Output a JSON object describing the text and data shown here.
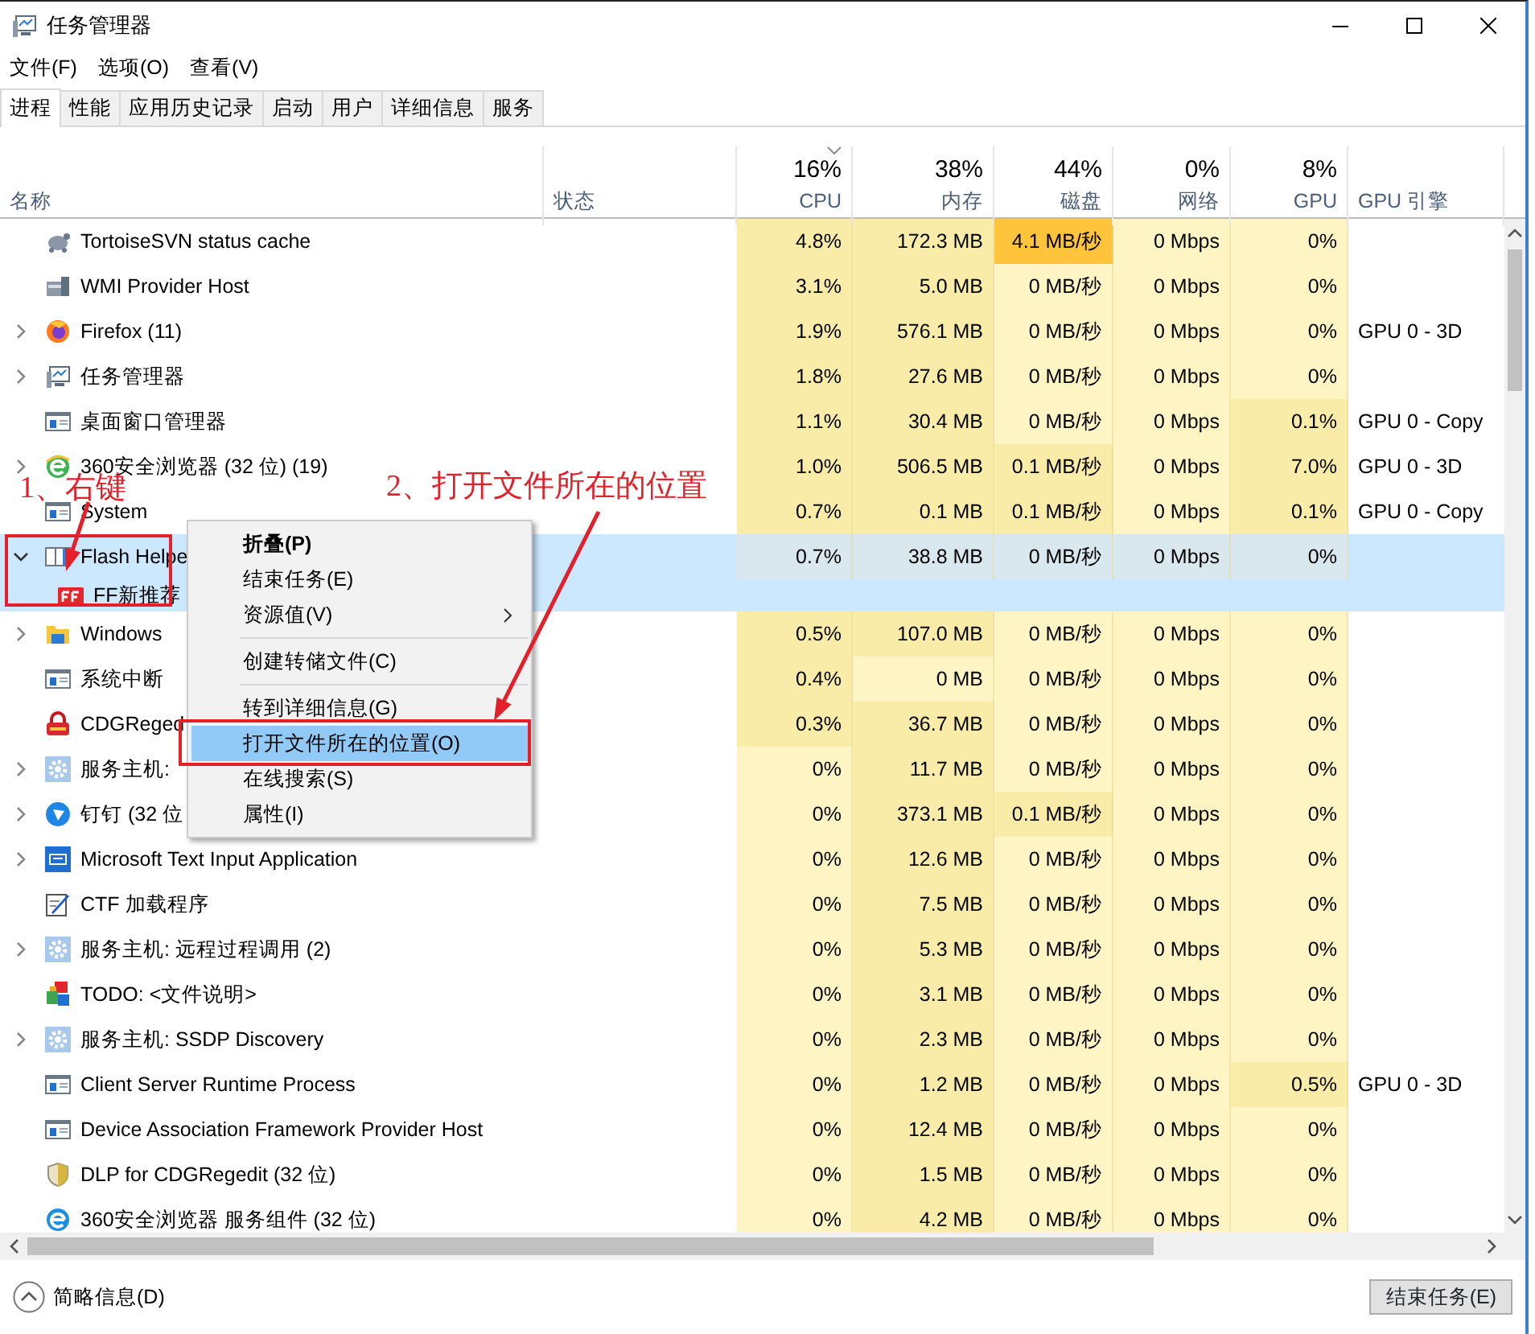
{
  "window": {
    "title": "任务管理器"
  },
  "menu": [
    "文件(F)",
    "选项(O)",
    "查看(V)"
  ],
  "tabs": [
    {
      "label": "进程",
      "selected": true
    },
    {
      "label": "性能",
      "selected": false
    },
    {
      "label": "应用历史记录",
      "selected": false
    },
    {
      "label": "启动",
      "selected": false
    },
    {
      "label": "用户",
      "selected": false
    },
    {
      "label": "详细信息",
      "selected": false
    },
    {
      "label": "服务",
      "selected": false
    }
  ],
  "columns": [
    {
      "kind": "text",
      "label": "名称"
    },
    {
      "kind": "text",
      "label": "状态"
    },
    {
      "kind": "metric",
      "percent": "16%",
      "label": "CPU",
      "sorted": true
    },
    {
      "kind": "metric",
      "percent": "38%",
      "label": "内存"
    },
    {
      "kind": "metric",
      "percent": "44%",
      "label": "磁盘"
    },
    {
      "kind": "metric",
      "percent": "0%",
      "label": "网络"
    },
    {
      "kind": "metric",
      "percent": "8%",
      "label": "GPU"
    },
    {
      "kind": "text",
      "label": "GPU 引擎"
    }
  ],
  "rows": [
    {
      "name": "TortoiseSVN status cache",
      "kind": "turtle",
      "selected": false,
      "cells": [
        {
          "text": "4.8%",
          "kind": "mid"
        },
        {
          "text": "172.3 MB",
          "kind": "mid"
        },
        {
          "text": "4.1 MB/秒",
          "kind": "high"
        },
        {
          "text": "0 Mbps",
          "kind": "low"
        },
        {
          "text": "0%",
          "kind": "low"
        }
      ]
    },
    {
      "name": "WMI Provider Host",
      "kind": "server",
      "selected": false,
      "cells": [
        {
          "text": "3.1%",
          "kind": "mid"
        },
        {
          "text": "5.0 MB",
          "kind": "mid"
        },
        {
          "text": "0 MB/秒",
          "kind": "low"
        },
        {
          "text": "0 Mbps",
          "kind": "low"
        },
        {
          "text": "0%",
          "kind": "low"
        }
      ]
    },
    {
      "name": "Firefox (11)",
      "kind": "globe",
      "expanded": false,
      "selected": false,
      "cells": [
        {
          "text": "1.9%",
          "kind": "mid"
        },
        {
          "text": "576.1 MB",
          "kind": "mid"
        },
        {
          "text": "0 MB/秒",
          "kind": "low"
        },
        {
          "text": "0 Mbps",
          "kind": "low"
        },
        {
          "text": "0%",
          "kind": "low"
        }
      ],
      "engine": "GPU 0 - 3D"
    },
    {
      "name": "任务管理器",
      "kind": "monitor",
      "expanded": false,
      "selected": false,
      "cells": [
        {
          "text": "1.8%",
          "kind": "mid"
        },
        {
          "text": "27.6 MB",
          "kind": "mid"
        },
        {
          "text": "0 MB/秒",
          "kind": "low"
        },
        {
          "text": "0 Mbps",
          "kind": "low"
        },
        {
          "text": "0%",
          "kind": "low"
        }
      ]
    },
    {
      "name": "桌面窗口管理器",
      "kind": "window",
      "selected": false,
      "cells": [
        {
          "text": "1.1%",
          "kind": "mid"
        },
        {
          "text": "30.4 MB",
          "kind": "mid"
        },
        {
          "text": "0 MB/秒",
          "kind": "low"
        },
        {
          "text": "0 Mbps",
          "kind": "low"
        },
        {
          "text": "0.1%",
          "kind": "mid"
        }
      ],
      "engine": "GPU 0 - Copy"
    },
    {
      "name": "360安全浏览器 (32 位) (19)",
      "kind": "browser",
      "expanded": false,
      "selected": false,
      "cells": [
        {
          "text": "1.0%",
          "kind": "mid"
        },
        {
          "text": "506.5 MB",
          "kind": "mid"
        },
        {
          "text": "0.1 MB/秒",
          "kind": "mid"
        },
        {
          "text": "0 Mbps",
          "kind": "low"
        },
        {
          "text": "7.0%",
          "kind": "mid"
        }
      ],
      "engine": "GPU 0 - 3D"
    },
    {
      "name": "System",
      "kind": "window",
      "selected": false,
      "cells": [
        {
          "text": "0.7%",
          "kind": "mid"
        },
        {
          "text": "0.1 MB",
          "kind": "mid"
        },
        {
          "text": "0.1 MB/秒",
          "kind": "mid"
        },
        {
          "text": "0 Mbps",
          "kind": "low"
        },
        {
          "text": "0.1%",
          "kind": "mid"
        }
      ],
      "engine": "GPU 0 - Copy"
    },
    {
      "name": "Flash Helpe",
      "kind": "split",
      "expanded": true,
      "selected": true,
      "cells": [
        {
          "text": "0.7%",
          "kind": "mid"
        },
        {
          "text": "38.8 MB",
          "kind": "mid"
        },
        {
          "text": "0 MB/秒",
          "kind": "low"
        },
        {
          "text": "0 Mbps",
          "kind": "low"
        },
        {
          "text": "0%",
          "kind": "low"
        }
      ],
      "children": [
        {
          "name": "FF新推荐",
          "kind": "badge"
        }
      ]
    },
    {
      "name": "Windows",
      "kind": "folder",
      "expanded": false,
      "selected": false,
      "cells": [
        {
          "text": "0.5%",
          "kind": "mid"
        },
        {
          "text": "107.0 MB",
          "kind": "mid"
        },
        {
          "text": "0 MB/秒",
          "kind": "low"
        },
        {
          "text": "0 Mbps",
          "kind": "low"
        },
        {
          "text": "0%",
          "kind": "low"
        }
      ]
    },
    {
      "name": "系统中断",
      "kind": "window",
      "selected": false,
      "cells": [
        {
          "text": "0.4%",
          "kind": "mid"
        },
        {
          "text": "0 MB",
          "kind": "low"
        },
        {
          "text": "0 MB/秒",
          "kind": "low"
        },
        {
          "text": "0 Mbps",
          "kind": "low"
        },
        {
          "text": "0%",
          "kind": "low"
        }
      ]
    },
    {
      "name": "CDGReged",
      "kind": "lock",
      "selected": false,
      "cells": [
        {
          "text": "0.3%",
          "kind": "mid"
        },
        {
          "text": "36.7 MB",
          "kind": "mid"
        },
        {
          "text": "0 MB/秒",
          "kind": "low"
        },
        {
          "text": "0 Mbps",
          "kind": "low"
        },
        {
          "text": "0%",
          "kind": "low"
        }
      ]
    },
    {
      "name": "服务主机:",
      "kind": "gear",
      "expanded": false,
      "selected": false,
      "cells": [
        {
          "text": "0%",
          "kind": "low"
        },
        {
          "text": "11.7 MB",
          "kind": "mid"
        },
        {
          "text": "0 MB/秒",
          "kind": "low"
        },
        {
          "text": "0 Mbps",
          "kind": "low"
        },
        {
          "text": "0%",
          "kind": "low"
        }
      ]
    },
    {
      "name": "钉钉 (32 位",
      "kind": "disc",
      "expanded": false,
      "selected": false,
      "cells": [
        {
          "text": "0%",
          "kind": "low"
        },
        {
          "text": "373.1 MB",
          "kind": "mid"
        },
        {
          "text": "0.1 MB/秒",
          "kind": "mid"
        },
        {
          "text": "0 Mbps",
          "kind": "low"
        },
        {
          "text": "0%",
          "kind": "low"
        }
      ]
    },
    {
      "name": "Microsoft Text Input Application",
      "kind": "keyboard",
      "expanded": false,
      "selected": false,
      "cells": [
        {
          "text": "0%",
          "kind": "low"
        },
        {
          "text": "12.6 MB",
          "kind": "mid"
        },
        {
          "text": "0 MB/秒",
          "kind": "low"
        },
        {
          "text": "0 Mbps",
          "kind": "low"
        },
        {
          "text": "0%",
          "kind": "low"
        }
      ]
    },
    {
      "name": "CTF 加载程序",
      "kind": "pen",
      "selected": false,
      "cells": [
        {
          "text": "0%",
          "kind": "low"
        },
        {
          "text": "7.5 MB",
          "kind": "mid"
        },
        {
          "text": "0 MB/秒",
          "kind": "low"
        },
        {
          "text": "0 Mbps",
          "kind": "low"
        },
        {
          "text": "0%",
          "kind": "low"
        }
      ]
    },
    {
      "name": "服务主机: 远程过程调用 (2)",
      "kind": "gear",
      "expanded": false,
      "selected": false,
      "cells": [
        {
          "text": "0%",
          "kind": "low"
        },
        {
          "text": "5.3 MB",
          "kind": "mid"
        },
        {
          "text": "0 MB/秒",
          "kind": "low"
        },
        {
          "text": "0 Mbps",
          "kind": "low"
        },
        {
          "text": "0%",
          "kind": "low"
        }
      ]
    },
    {
      "name": "TODO: <文件说明>",
      "kind": "tiles",
      "selected": false,
      "cells": [
        {
          "text": "0%",
          "kind": "low"
        },
        {
          "text": "3.1 MB",
          "kind": "mid"
        },
        {
          "text": "0 MB/秒",
          "kind": "low"
        },
        {
          "text": "0 Mbps",
          "kind": "low"
        },
        {
          "text": "0%",
          "kind": "low"
        }
      ]
    },
    {
      "name": "服务主机: SSDP Discovery",
      "kind": "gear",
      "expanded": false,
      "selected": false,
      "cells": [
        {
          "text": "0%",
          "kind": "low"
        },
        {
          "text": "2.3 MB",
          "kind": "mid"
        },
        {
          "text": "0 MB/秒",
          "kind": "low"
        },
        {
          "text": "0 Mbps",
          "kind": "low"
        },
        {
          "text": "0%",
          "kind": "low"
        }
      ]
    },
    {
      "name": "Client Server Runtime Process",
      "kind": "window",
      "selected": false,
      "cells": [
        {
          "text": "0%",
          "kind": "low"
        },
        {
          "text": "1.2 MB",
          "kind": "mid"
        },
        {
          "text": "0 MB/秒",
          "kind": "low"
        },
        {
          "text": "0 Mbps",
          "kind": "low"
        },
        {
          "text": "0.5%",
          "kind": "mid"
        }
      ],
      "engine": "GPU 0 - 3D"
    },
    {
      "name": "Device Association Framework Provider Host",
      "kind": "window",
      "selected": false,
      "cells": [
        {
          "text": "0%",
          "kind": "low"
        },
        {
          "text": "12.4 MB",
          "kind": "mid"
        },
        {
          "text": "0 MB/秒",
          "kind": "low"
        },
        {
          "text": "0 Mbps",
          "kind": "low"
        },
        {
          "text": "0%",
          "kind": "low"
        }
      ]
    },
    {
      "name": "DLP for CDGRegedit (32 位)",
      "kind": "shield",
      "selected": false,
      "cells": [
        {
          "text": "0%",
          "kind": "low"
        },
        {
          "text": "1.5 MB",
          "kind": "mid"
        },
        {
          "text": "0 MB/秒",
          "kind": "low"
        },
        {
          "text": "0 Mbps",
          "kind": "low"
        },
        {
          "text": "0%",
          "kind": "low"
        }
      ]
    },
    {
      "name": "360安全浏览器 服务组件 (32 位)",
      "kind": "browser2",
      "selected": false,
      "cells": [
        {
          "text": "0%",
          "kind": "low"
        },
        {
          "text": "4.2 MB",
          "kind": "mid"
        },
        {
          "text": "0 MB/秒",
          "kind": "low"
        },
        {
          "text": "0 Mbps",
          "kind": "low"
        },
        {
          "text": "0%",
          "kind": "low"
        }
      ]
    }
  ],
  "context_menu": [
    {
      "label": "折叠(P)",
      "default": true,
      "selected": false
    },
    {
      "label": "结束任务(E)",
      "default": false,
      "selected": false
    },
    {
      "label": "资源值(V)",
      "default": false,
      "selected": false,
      "submenu": true
    },
    {
      "label": "创建转储文件(C)",
      "default": false,
      "selected": false,
      "separator_before": true
    },
    {
      "label": "转到详细信息(G)",
      "default": false,
      "selected": false,
      "separator_before": true
    },
    {
      "label": "打开文件所在的位置(O)",
      "default": false,
      "selected": true
    },
    {
      "label": "在线搜索(S)",
      "default": false,
      "selected": false
    },
    {
      "label": "属性(I)",
      "default": false,
      "selected": false
    }
  ],
  "annotations": [
    {
      "kind": "box"
    },
    {
      "kind": "label",
      "text": "1、右键"
    },
    {
      "kind": "arrow"
    },
    {
      "kind": "label",
      "text": "2、打开文件所在的位置"
    },
    {
      "kind": "arrow"
    },
    {
      "kind": "box"
    }
  ],
  "footer": {
    "details_link": "简略信息(D)",
    "end_button": "结束任务(E)"
  }
}
